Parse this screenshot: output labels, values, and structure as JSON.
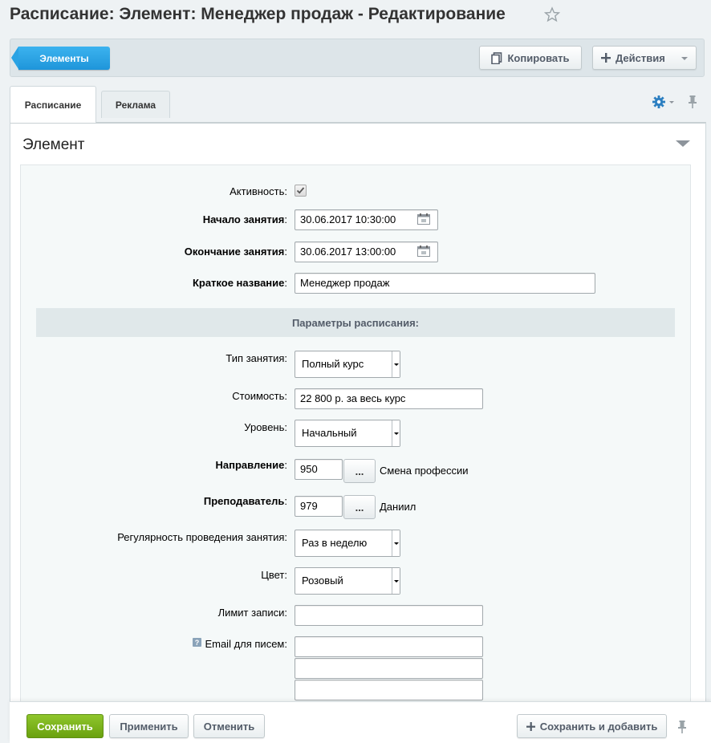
{
  "header": {
    "title": "Расписание: Элемент: Менеджер продаж - Редактирование"
  },
  "toolbar": {
    "back_label": "Элементы",
    "copy_label": "Копировать",
    "actions_label": "Действия"
  },
  "tabs": [
    {
      "label": "Расписание",
      "active": true
    },
    {
      "label": "Реклама",
      "active": false
    }
  ],
  "section": {
    "title": "Элемент"
  },
  "form": {
    "active": {
      "label": "Активность",
      "checked": true
    },
    "start": {
      "label": "Начало занятия",
      "value": "30.06.2017 10:30:00"
    },
    "end": {
      "label": "Окончание занятия",
      "value": "30.06.2017 13:00:00"
    },
    "short_name": {
      "label": "Краткое название",
      "value": "Менеджер продаж"
    },
    "params_header": "Параметры расписания:",
    "lesson_type": {
      "label": "Тип занятия",
      "value": "Полный курс"
    },
    "cost": {
      "label": "Стоимость",
      "value": "22 800 р. за весь курс"
    },
    "level": {
      "label": "Уровень",
      "value": "Начальный"
    },
    "direction": {
      "label": "Направление",
      "value": "950",
      "button": "...",
      "display": "Смена профессии"
    },
    "teacher": {
      "label": "Преподаватель",
      "value": "979",
      "button": "...",
      "display": "Даниил"
    },
    "regularity": {
      "label": "Регулярность проведения занятия",
      "value": "Раз в неделю"
    },
    "color": {
      "label": "Цвет",
      "value": "Розовый"
    },
    "limit": {
      "label": "Лимит записи",
      "value": ""
    },
    "email": {
      "label": "Email для писем",
      "help": "?",
      "values": [
        "",
        "",
        ""
      ]
    }
  },
  "footer": {
    "save_label": "Сохранить",
    "apply_label": "Применить",
    "cancel_label": "Отменить",
    "save_add_label": "Сохранить и добавить"
  },
  "colors": {
    "accent_blue": "#1e95da",
    "save_green": "#6aa10e",
    "page_bg": "#eef2f4"
  },
  "icons": [
    "star-icon",
    "copy-icon",
    "plus-icon",
    "gear-icon",
    "pin-icon",
    "calendar-icon",
    "help-icon",
    "chevron-down-icon"
  ]
}
